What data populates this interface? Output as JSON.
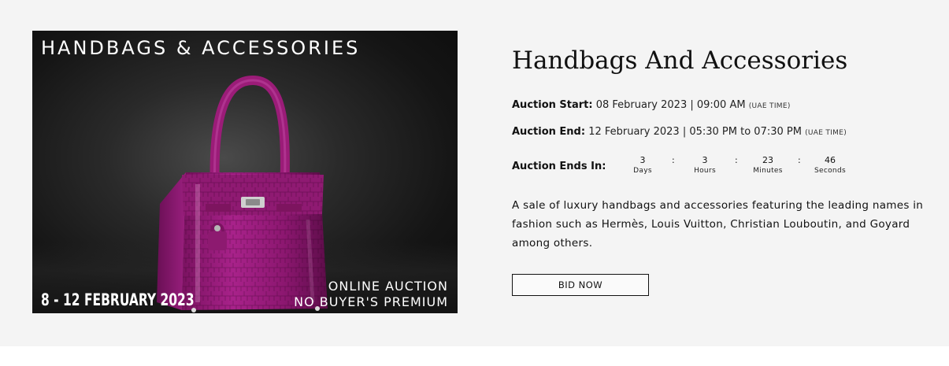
{
  "banner": {
    "headline": "HANDBAGS & ACCESSORIES",
    "dates": "8 - 12 FEBRUARY 2023",
    "line1": "ONLINE AUCTION",
    "line2": "NO BUYER'S PREMIUM"
  },
  "auction": {
    "title": "Handbags And Accessories",
    "start_label": "Auction Start:",
    "start_value": "08 February 2023 | 09:00 AM",
    "start_tz": "(UAE TIME)",
    "end_label": "Auction End:",
    "end_value": "12 February 2023 | 05:30 PM to 07:30 PM",
    "end_tz": "(UAE TIME)",
    "ends_in_label": "Auction Ends In:",
    "countdown": {
      "days": "3",
      "days_label": "Days",
      "hours": "3",
      "hours_label": "Hours",
      "minutes": "23",
      "minutes_label": "Minutes",
      "seconds": "46",
      "seconds_label": "Seconds",
      "separator": ":"
    },
    "description": "A sale of luxury handbags and accessories featuring the leading names in fashion such as Hermès, Louis Vuitton, Christian Louboutin, and Goyard among others.",
    "bid_button": "BID NOW"
  },
  "colors": {
    "panel_bg": "#f4f4f4",
    "bag": "#9b1c78"
  }
}
